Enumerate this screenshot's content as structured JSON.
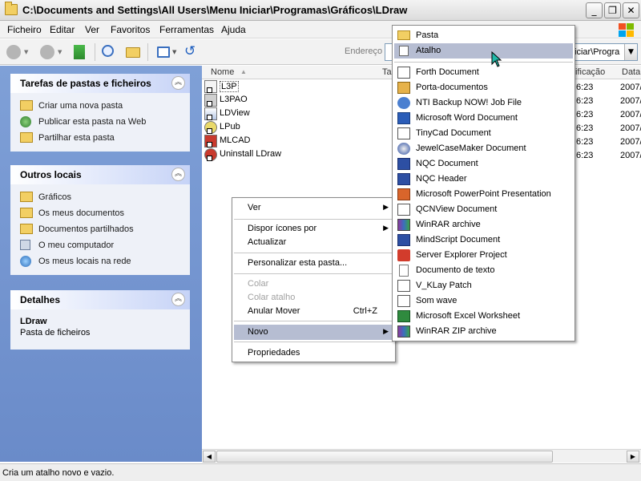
{
  "window": {
    "title": "C:\\Documents and Settings\\All Users\\Menu Iniciar\\Programas\\Gráficos\\LDraw",
    "min": "_",
    "max": "❐",
    "close": "✕"
  },
  "menubar": [
    "Ficheiro",
    "Editar",
    "Ver",
    "Favoritos",
    "Ferramentas",
    "Ajuda"
  ],
  "toolbar": {
    "address_label": "Endereço",
    "address_value": "iciar\\Progra"
  },
  "left_pane": {
    "tasks": {
      "title": "Tarefas de pastas e ficheiros",
      "items": [
        "Criar uma nova pasta",
        "Publicar esta pasta na Web",
        "Partilhar esta pasta"
      ]
    },
    "places": {
      "title": "Outros locais",
      "items": [
        "Gráficos",
        "Os meus documentos",
        "Documentos partilhados",
        "O meu computador",
        "Os meus locais na rede"
      ]
    },
    "details": {
      "title": "Detalhes",
      "name": "LDraw",
      "type": "Pasta de ficheiros"
    }
  },
  "file_list": {
    "headers": {
      "name": "Nome",
      "size": "Ta",
      "modified": "ificação",
      "date": "Data"
    },
    "files": [
      "L3P",
      "L3PAO",
      "LDView",
      "LPub",
      "MLCAD",
      "Uninstall LDraw"
    ],
    "times": [
      "6:23",
      "6:23",
      "6:23",
      "6:23",
      "6:23",
      "6:23"
    ],
    "years": [
      "2007/",
      "2007/",
      "2007/",
      "2007/",
      "2007/",
      "2007/"
    ]
  },
  "context_menu": {
    "ver": "Ver",
    "dispor": "Dispor ícones por",
    "atualizar": "Actualizar",
    "personalizar": "Personalizar esta pasta...",
    "colar": "Colar",
    "colar_atalho": "Colar atalho",
    "anular": "Anular Mover",
    "anular_sc": "Ctrl+Z",
    "novo": "Novo",
    "propriedades": "Propriedades"
  },
  "submenu": {
    "pasta": "Pasta",
    "atalho": "Atalho",
    "items": [
      "Forth Document",
      "Porta-documentos",
      "NTI Backup NOW! Job File",
      "Microsoft Word Document",
      "TinyCad Document",
      "JewelCaseMaker Document",
      "NQC Document",
      "NQC Header",
      "Microsoft PowerPoint Presentation",
      "QCNView Document",
      "WinRAR archive",
      "MindScript Document",
      "Server Explorer Project",
      "Documento de texto",
      "V_KLay Patch",
      "Som wave",
      "Microsoft Excel Worksheet",
      "WinRAR ZIP archive"
    ]
  },
  "status": "Cria um atalho novo e vazio."
}
